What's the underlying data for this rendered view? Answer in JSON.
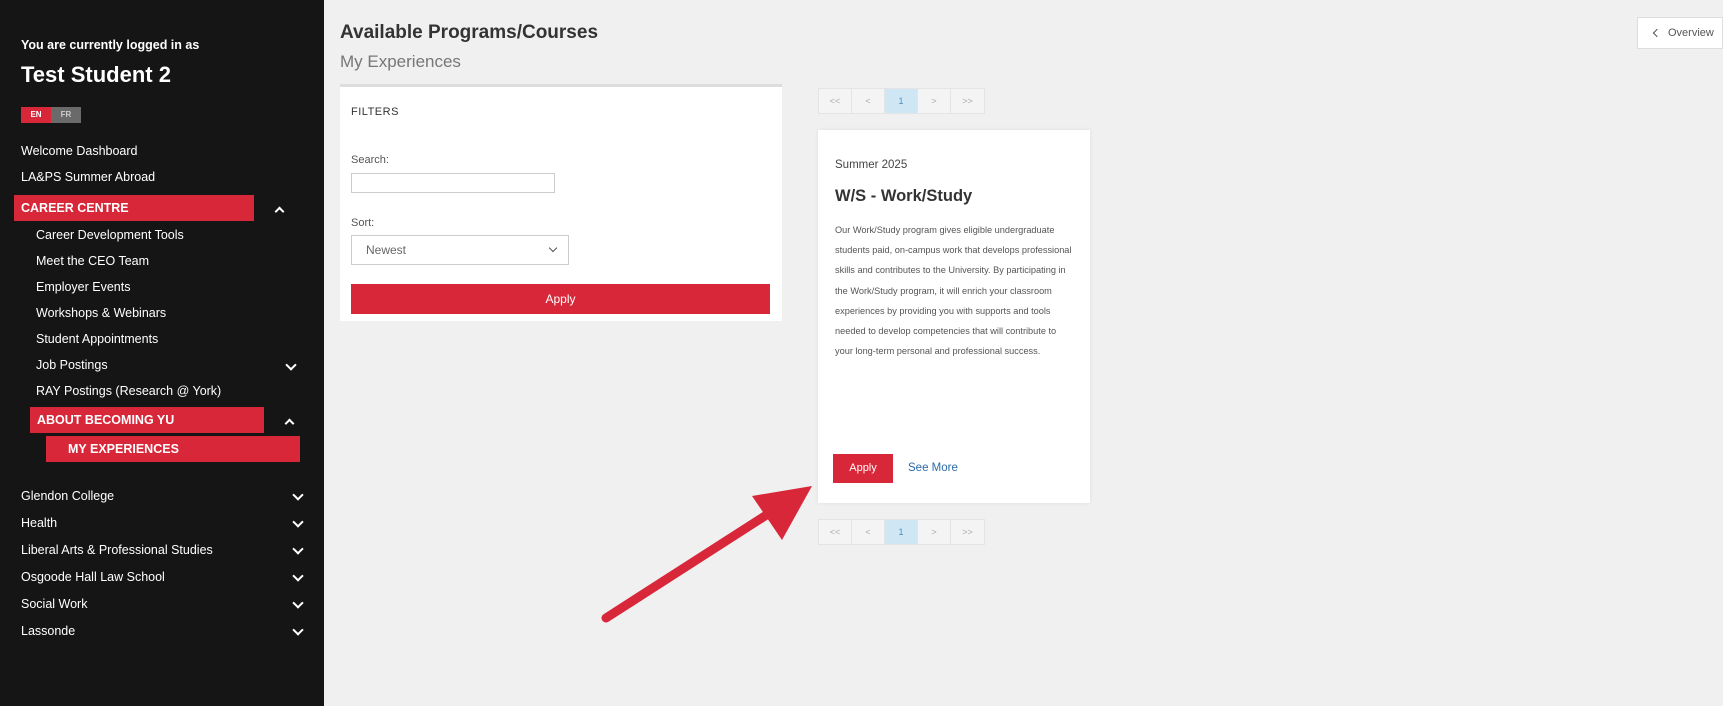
{
  "sidebar": {
    "logged_in_label": "You are currently logged in as",
    "user_name": "Test Student 2",
    "lang": {
      "active": "EN",
      "inactive": "FR"
    },
    "items": [
      {
        "label": "Welcome Dashboard"
      },
      {
        "label": "LA&PS Summer Abroad"
      },
      {
        "label": "CAREER CENTRE"
      },
      {
        "label": "Career Development Tools"
      },
      {
        "label": "Meet the CEO Team"
      },
      {
        "label": "Employer Events"
      },
      {
        "label": "Workshops & Webinars"
      },
      {
        "label": "Student Appointments"
      },
      {
        "label": "Job Postings"
      },
      {
        "label": "RAY Postings (Research @ York)"
      },
      {
        "label": "ABOUT BECOMING YU"
      },
      {
        "label": "MY EXPERIENCES"
      },
      {
        "label": "Glendon College"
      },
      {
        "label": "Health"
      },
      {
        "label": "Liberal Arts & Professional Studies"
      },
      {
        "label": "Osgoode Hall Law School"
      },
      {
        "label": "Social Work"
      },
      {
        "label": "Lassonde"
      }
    ]
  },
  "header": {
    "title": "Available Programs/Courses",
    "subtitle": "My Experiences",
    "overview_label": "Overview"
  },
  "filters": {
    "title": "FILTERS",
    "search_label": "Search:",
    "search_value": "",
    "sort_label": "Sort:",
    "sort_value": "Newest",
    "apply_label": "Apply"
  },
  "pagination": {
    "first": "<<",
    "prev": "<",
    "current": "1",
    "next": ">",
    "last": ">>"
  },
  "card": {
    "term": "Summer 2025",
    "title": "W/S - Work/Study",
    "description": "Our Work/Study program gives eligible undergraduate students paid, on-campus work that develops professional skills and contributes to the University. By participating in the Work/Study program, it will enrich your classroom experiences by providing you with supports and tools needed to develop competencies that will contribute to your long-term personal and professional success.",
    "apply_label": "Apply",
    "see_more_label": "See More"
  },
  "colors": {
    "brand_red": "#d9273a",
    "sidebar_bg": "#151515",
    "link_blue": "#2a6aa8"
  }
}
